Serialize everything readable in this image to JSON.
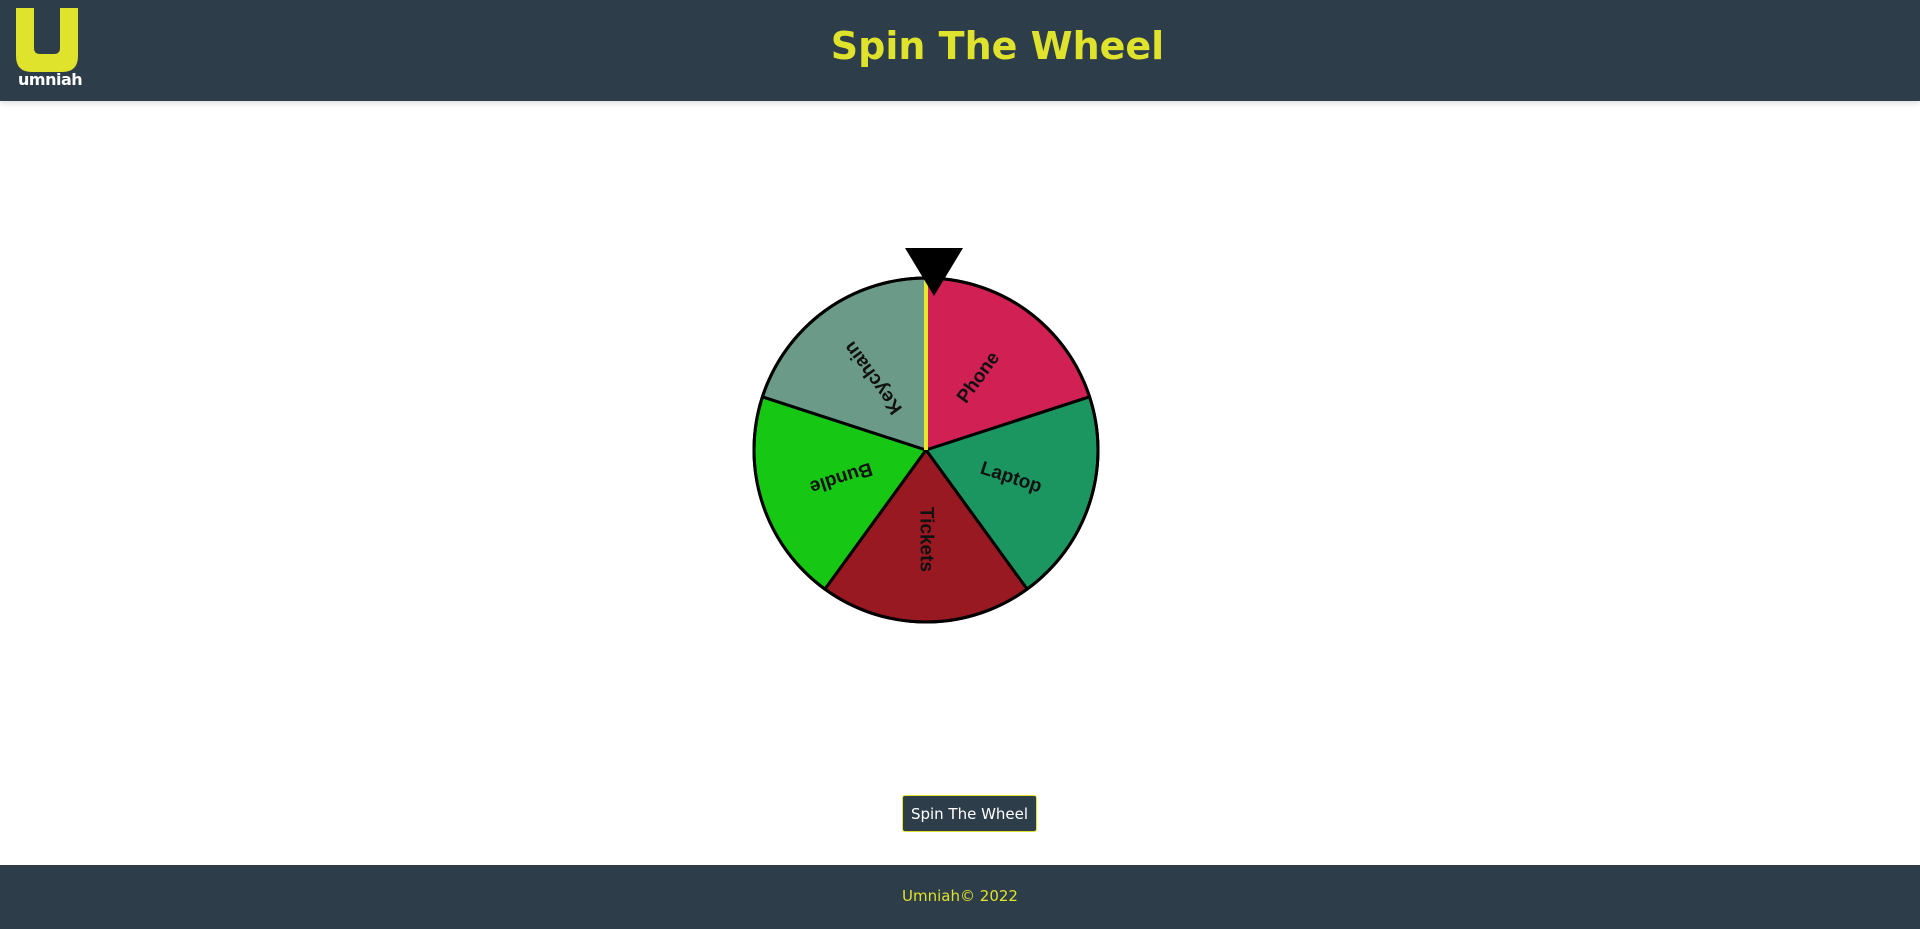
{
  "header": {
    "logo_text": "umniah",
    "title": "Spin The Wheel"
  },
  "wheel": {
    "segments": [
      {
        "label": "Phone",
        "color": "#d12053"
      },
      {
        "label": "Laptop",
        "color": "#1c9660"
      },
      {
        "label": "Tickets",
        "color": "#991922"
      },
      {
        "label": "Bundle",
        "color": "#16c713"
      },
      {
        "label": "Keychain",
        "color": "#6b9b88"
      }
    ],
    "pointer_color": "#000000",
    "marker_color": "#e8e82a"
  },
  "spin_button": {
    "label": "Spin The Wheel"
  },
  "footer": {
    "text": "Umniah© 2022"
  },
  "colors": {
    "brand_dark": "#2e3d4a",
    "brand_accent": "#dfe32b"
  }
}
